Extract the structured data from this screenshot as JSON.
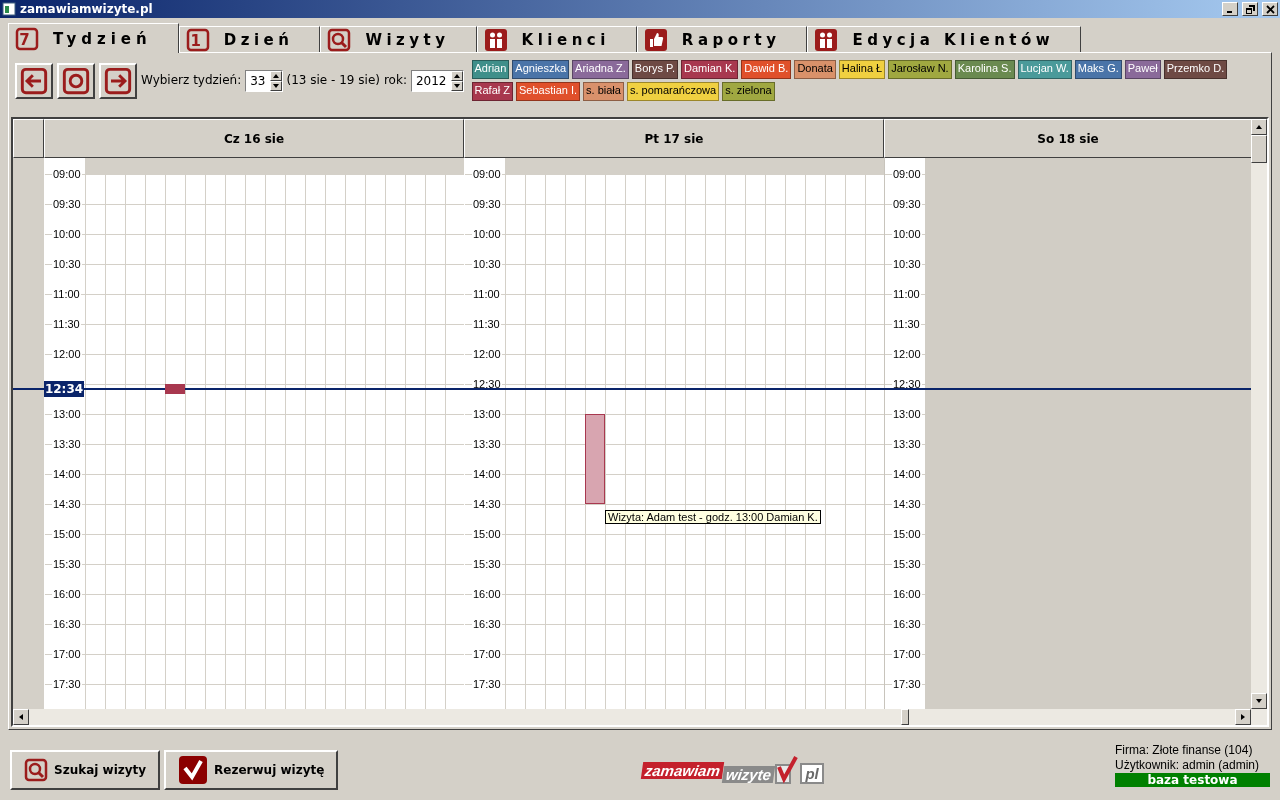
{
  "window": {
    "title": "zamawiamwizyte.pl"
  },
  "tabs": [
    {
      "label": "Tydzień",
      "kind": "digit",
      "glyph": "7",
      "selected": true
    },
    {
      "label": "Dzień",
      "kind": "digit",
      "glyph": "1",
      "selected": false
    },
    {
      "label": "Wizyty",
      "kind": "search",
      "selected": false
    },
    {
      "label": "Klienci",
      "kind": "people",
      "selected": false
    },
    {
      "label": "Raporty",
      "kind": "thumb",
      "selected": false
    },
    {
      "label": "Edycja Klientów",
      "kind": "people",
      "selected": false
    }
  ],
  "toolbar": {
    "nav_buttons": [
      {
        "kind": "prev"
      },
      {
        "kind": "today"
      },
      {
        "kind": "next"
      }
    ],
    "week_label": "Wybierz tydzień:",
    "week": "33",
    "range": "(13 sie - 19 sie)",
    "year_label": "rok:",
    "year": "2012"
  },
  "staff": [
    {
      "name": "Adrian",
      "color": "#3f8f8a"
    },
    {
      "name": "Agnieszka",
      "color": "#4a74a8"
    },
    {
      "name": "Ariadna Z.",
      "color": "#8a6a9a"
    },
    {
      "name": "Borys P.",
      "color": "#6e4a44"
    },
    {
      "name": "Damian K.",
      "color": "#a8384f"
    },
    {
      "name": "Dawid B.",
      "color": "#e0502a"
    },
    {
      "name": "Donata",
      "color": "#d9916a"
    },
    {
      "name": "Halina Ł",
      "color": "#f0d040"
    },
    {
      "name": "Jarosław N.",
      "color": "#a0a840"
    },
    {
      "name": "Karolina S.",
      "color": "#6a8a50"
    },
    {
      "name": "Lucjan W.",
      "color": "#4a9a9a"
    },
    {
      "name": "Maks G.",
      "color": "#4a74a8"
    },
    {
      "name": "Paweł",
      "color": "#8a6a9a"
    },
    {
      "name": "Przemko D.",
      "color": "#6e4a44"
    },
    {
      "name": "Rafał Z",
      "color": "#a8384e"
    },
    {
      "name": "Sebastian I.",
      "color": "#e0502b"
    },
    {
      "name": "s. biała",
      "color": "#d9916b"
    },
    {
      "name": "s. pomarańczowa",
      "color": "#f0d041"
    },
    {
      "name": "s. zielona",
      "color": "#a0a841"
    }
  ],
  "calendar": {
    "now": "12:34",
    "days": [
      {
        "label": "Cz 16 sie",
        "open": true,
        "times": [
          "09:00",
          "09:30",
          "10:00",
          "10:30",
          "11:00",
          "11:30",
          "12:00",
          "13:00",
          "13:30",
          "14:00",
          "14:30",
          "15:00",
          "15:30",
          "16:00",
          "16:30",
          "17:00",
          "17:30"
        ],
        "events": [
          {
            "kind": "solid",
            "color": "#a8384f"
          }
        ]
      },
      {
        "label": "Pt 17 sie",
        "open": true,
        "times": [
          "09:00",
          "09:30",
          "10:00",
          "10:30",
          "11:00",
          "11:30",
          "12:00",
          "12:30",
          "13:00",
          "13:30",
          "14:00",
          "14:30",
          "15:00",
          "15:30",
          "16:00",
          "16:30",
          "17:00",
          "17:30"
        ],
        "events": [
          {
            "kind": "pale",
            "color": "#a8384f",
            "tooltip": "Wizyta: Adam test - godz. 13:00 Damian K."
          }
        ]
      },
      {
        "label": "So 18 sie",
        "open": false,
        "times": [
          "09:00",
          "09:30",
          "10:00",
          "10:30",
          "11:00",
          "11:30",
          "12:00",
          "12:30",
          "13:00",
          "13:30",
          "14:00",
          "14:30",
          "15:00",
          "15:30",
          "16:00",
          "16:30",
          "17:00",
          "17:30"
        ]
      }
    ]
  },
  "buttons": [
    {
      "label": "Szukaj wizyty",
      "kind": "search"
    },
    {
      "label": "Rezerwuj wizytę",
      "kind": "check"
    }
  ],
  "logo": [
    "zamawiam",
    "wizyte",
    "pl"
  ],
  "info": {
    "company": "Firma: Złote finanse (104)",
    "user": "Użytkownik: admin (admin)",
    "database": "baza testowa"
  }
}
